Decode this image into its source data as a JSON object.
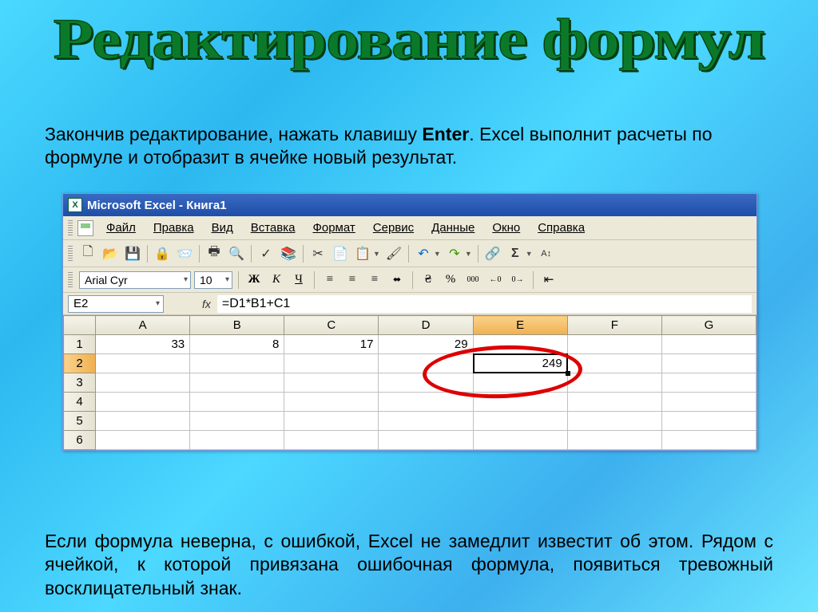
{
  "title_art": "Редактирование формул",
  "paragraph1_a": "Закончив редактирование, нажать клавишу ",
  "paragraph1_b": "Enter",
  "paragraph1_c": ". Excel выполнит расчеты по формуле и отобразит в ячейке новый результат.",
  "paragraph2": "Если формула неверна, с ошибкой, Excel не замедлит  известит об этом. Рядом с ячейкой, к которой привязана ошибочная формула, появиться тревожный восклицательный знак.",
  "window_title": "Microsoft Excel - Книга1",
  "menu": [
    "Файл",
    "Правка",
    "Вид",
    "Вставка",
    "Формат",
    "Сервис",
    "Данные",
    "Окно",
    "Справка"
  ],
  "font_name": "Arial Cyr",
  "font_size": "10",
  "name_box": "E2",
  "fx_label": "fx",
  "formula": "=D1*B1+C1",
  "columns": [
    "A",
    "B",
    "C",
    "D",
    "E",
    "F",
    "G"
  ],
  "row_numbers": [
    "1",
    "2",
    "3",
    "4",
    "5",
    "6"
  ],
  "cells": {
    "A1": "33",
    "B1": "8",
    "C1": "17",
    "D1": "29",
    "E2": "249"
  },
  "fmt_btns": {
    "bold": "Ж",
    "italic": "К",
    "underline": "Ч",
    "pct": "%",
    "thousands": "000"
  },
  "toolbar_glyphs": {
    "new": "🗋",
    "open": "📂",
    "save": "💾",
    "perm": "🔒",
    "mail": "📨",
    "print": "🖶",
    "preview": "🔍",
    "spell": "✓",
    "research": "📚",
    "cut": "✂",
    "copy": "📄",
    "paste": "📋",
    "brush": "🖌",
    "undo": "↶",
    "redo": "↷",
    "link": "🔗",
    "sum": "Σ",
    "sort": "A↕"
  },
  "fmt_glyphs": {
    "al": "≡",
    "ac": "≡",
    "ar": "≡",
    "merge": "⬌",
    "currency": "₴",
    "comma": ",",
    "dec_inc": "←0",
    "dec_dec": "0→",
    "indent_dec": "⇤"
  }
}
